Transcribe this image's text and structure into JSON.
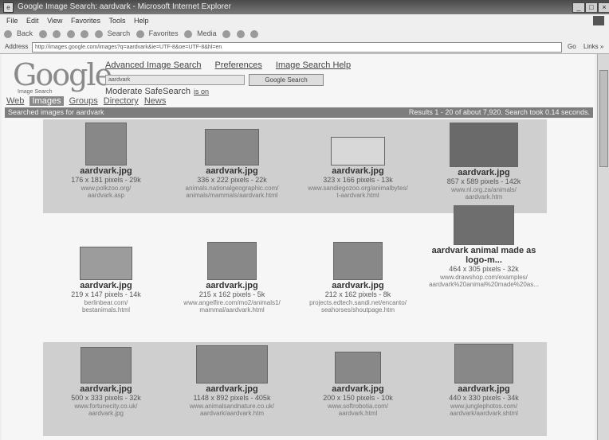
{
  "window": {
    "title": "Google Image Search: aardvark - Microsoft Internet Explorer",
    "controls": [
      "_",
      "□",
      "×"
    ]
  },
  "menu": [
    "File",
    "Edit",
    "View",
    "Favorites",
    "Tools",
    "Help"
  ],
  "toolbar": [
    "Back",
    "Search",
    "Favorites",
    "Media"
  ],
  "address": {
    "label": "Address",
    "url": "http://images.google.com/images?q=aardvark&ie=UTF-8&oe=UTF-8&hl=en",
    "go": "Go",
    "links": "Links »"
  },
  "logo": {
    "word": "Google",
    "sub": "Image Search"
  },
  "top_links": [
    "Advanced Image Search",
    "Preferences",
    "Image Search Help"
  ],
  "search": {
    "value": "aardvark",
    "button": "Google Search"
  },
  "safesearch": {
    "label": "Moderate SafeSearch",
    "state": "is on"
  },
  "tabs": [
    "Web",
    "Images",
    "Groups",
    "Directory",
    "News"
  ],
  "results_bar": {
    "left": "Searched images for aardvark",
    "right": "Results 1 - 20 of about 7,920. Search took 0.14 seconds."
  },
  "rows": [
    [
      {
        "name": "aardvark.jpg",
        "dims": "176 x 181 pixels - 29k",
        "url1": "www.polkzoo.org/",
        "url2": "aardvark.asp"
      },
      {
        "name": "aardvark.jpg",
        "dims": "336 x 222 pixels - 22k",
        "url1": "animals.nationalgeographic.com/",
        "url2": "animals/mammals/aardvark.html"
      },
      {
        "name": "aardvark.jpg",
        "dims": "323 x 166 pixels - 13k",
        "url1": "www.sandiegozoo.org/animalbytes/",
        "url2": "t-aardvark.html"
      },
      {
        "name": "aardvark.jpg",
        "dims": "857 x 589 pixels - 142k",
        "url1": "www.nl.org.za/animals/",
        "url2": "aardvark.htm"
      }
    ],
    [
      {
        "name": "aardvark.jpg",
        "dims": "219 x 147 pixels - 14k",
        "url1": "berlinbear.com/",
        "url2": "bestanimals.html"
      },
      {
        "name": "aardvark.jpg",
        "dims": "215 x 162 pixels - 5k",
        "url1": "www.angelfire.com/mo2/animals1/",
        "url2": "mammal/aardvark.html"
      },
      {
        "name": "aardvark.jpg",
        "dims": "212 x 162 pixels - 8k",
        "url1": "projects.edtech.sandi.net/encanto/",
        "url2": "seahorses/shoutpage.htm"
      },
      {
        "name": "aardvark animal made as logo-m...",
        "dims": "464 x 305 pixels - 32k",
        "url1": "www.drawshop.com/examples/",
        "url2": "aardvark%20animal%20made%20as..."
      }
    ],
    [
      {
        "name": "aardvark.jpg",
        "dims": "500 x 333 pixels - 32k",
        "url1": "www.fortunecity.co.uk/",
        "url2": "aardvark.jpg"
      },
      {
        "name": "aardvark.jpg",
        "dims": "1148 x 892 pixels - 405k",
        "url1": "www.animalsandnature.co.uk/",
        "url2": "aardvark/aardvark.htm"
      },
      {
        "name": "aardvark.jpg",
        "dims": "200 x 150 pixels - 10k",
        "url1": "www.softrobotia.com/",
        "url2": "aardvark.html"
      },
      {
        "name": "aardvark.jpg",
        "dims": "440 x 330 pixels - 34k",
        "url1": "www.junglephotos.com/",
        "url2": "aardvark/aardvark.shtml"
      }
    ]
  ]
}
